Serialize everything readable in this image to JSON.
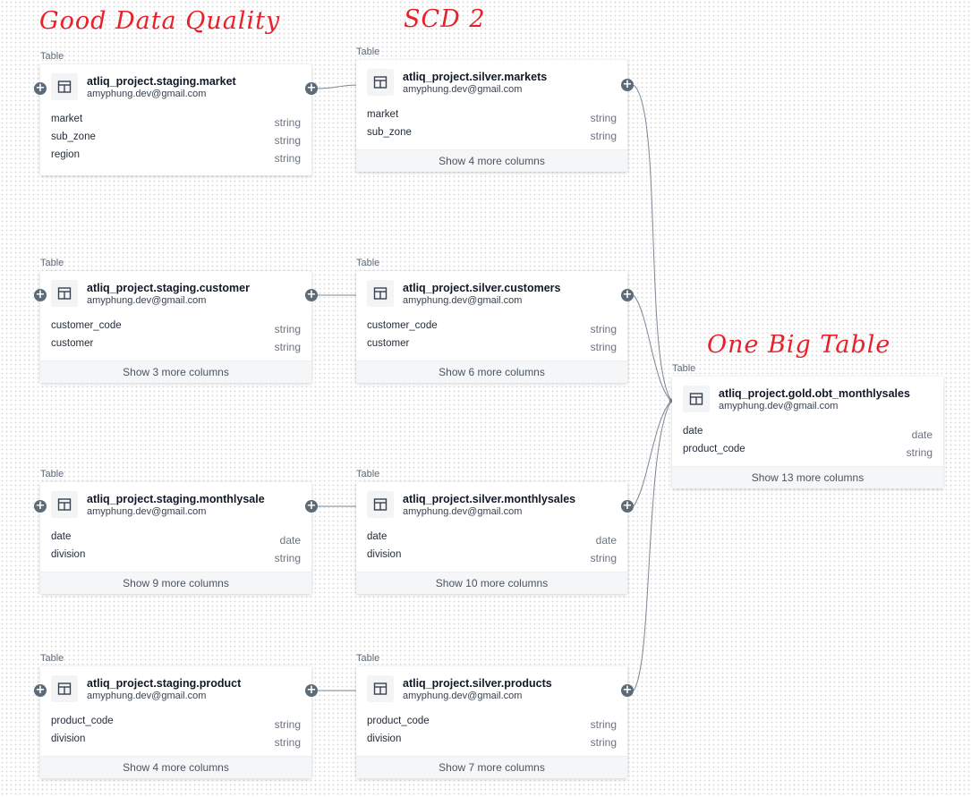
{
  "annotations": {
    "good_quality": "Good Data Quality",
    "scd2": "SCD 2",
    "obt": "One Big Table"
  },
  "nodes": {
    "staging_market": {
      "type_label": "Table",
      "title": "atliq_project.staging.market",
      "owner": "amyphung.dev@gmail.com",
      "columns": [
        {
          "name": "market",
          "type": "string"
        },
        {
          "name": "sub_zone",
          "type": "string"
        },
        {
          "name": "region",
          "type": "string"
        }
      ]
    },
    "silver_markets": {
      "type_label": "Table",
      "title": "atliq_project.silver.markets",
      "owner": "amyphung.dev@gmail.com",
      "columns": [
        {
          "name": "market",
          "type": "string"
        },
        {
          "name": "sub_zone",
          "type": "string"
        }
      ],
      "show_more": "Show 4 more columns"
    },
    "staging_customer": {
      "type_label": "Table",
      "title": "atliq_project.staging.customer",
      "owner": "amyphung.dev@gmail.com",
      "columns": [
        {
          "name": "customer_code",
          "type": "string"
        },
        {
          "name": "customer",
          "type": "string"
        }
      ],
      "show_more": "Show 3 more columns"
    },
    "silver_customers": {
      "type_label": "Table",
      "title": "atliq_project.silver.customers",
      "owner": "amyphung.dev@gmail.com",
      "columns": [
        {
          "name": "customer_code",
          "type": "string"
        },
        {
          "name": "customer",
          "type": "string"
        }
      ],
      "show_more": "Show 6 more columns"
    },
    "gold_obt": {
      "type_label": "Table",
      "title": "atliq_project.gold.obt_monthlysales",
      "owner": "amyphung.dev@gmail.com",
      "columns": [
        {
          "name": "date",
          "type": "date"
        },
        {
          "name": "product_code",
          "type": "string"
        }
      ],
      "show_more": "Show 13 more columns"
    },
    "staging_monthlysale": {
      "type_label": "Table",
      "title": "atliq_project.staging.monthlysale",
      "owner": "amyphung.dev@gmail.com",
      "columns": [
        {
          "name": "date",
          "type": "date"
        },
        {
          "name": "division",
          "type": "string"
        }
      ],
      "show_more": "Show 9 more columns"
    },
    "silver_monthlysales": {
      "type_label": "Table",
      "title": "atliq_project.silver.monthlysales",
      "owner": "amyphung.dev@gmail.com",
      "columns": [
        {
          "name": "date",
          "type": "date"
        },
        {
          "name": "division",
          "type": "string"
        }
      ],
      "show_more": "Show 10 more columns"
    },
    "staging_product": {
      "type_label": "Table",
      "title": "atliq_project.staging.product",
      "owner": "amyphung.dev@gmail.com",
      "columns": [
        {
          "name": "product_code",
          "type": "string"
        },
        {
          "name": "division",
          "type": "string"
        }
      ],
      "show_more": "Show 4 more columns"
    },
    "silver_products": {
      "type_label": "Table",
      "title": "atliq_project.silver.products",
      "owner": "amyphung.dev@gmail.com",
      "columns": [
        {
          "name": "product_code",
          "type": "string"
        },
        {
          "name": "division",
          "type": "string"
        }
      ],
      "show_more": "Show 7 more columns"
    }
  },
  "colors": {
    "annotation": "#e8202a",
    "edge": "#7b8794",
    "plus_button": "#5d6b78"
  }
}
